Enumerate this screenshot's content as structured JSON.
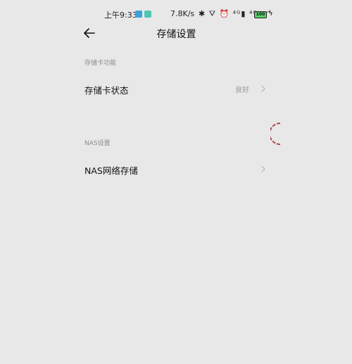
{
  "status_bar": {
    "time": "上午9:33",
    "network_speed": "7.8K/s",
    "icons": "✱ ⛛ ⏰ ⁴ᴳ▮ ⁴ᴳ▮ ◠",
    "battery": "100",
    "charge_symbol": "ϟ"
  },
  "header": {
    "title": "存储设置"
  },
  "sections": [
    {
      "label": "存储卡功能",
      "rows": [
        {
          "title": "存储卡状态",
          "value": "良好"
        }
      ]
    },
    {
      "label": "NAS设置",
      "rows": [
        {
          "title": "NAS网络存储",
          "value": ""
        }
      ]
    }
  ],
  "colors": {
    "background": "#e8e8e8",
    "text_primary": "#111111",
    "text_secondary": "#8a8a8a",
    "loading_arc": "#b0444e"
  }
}
